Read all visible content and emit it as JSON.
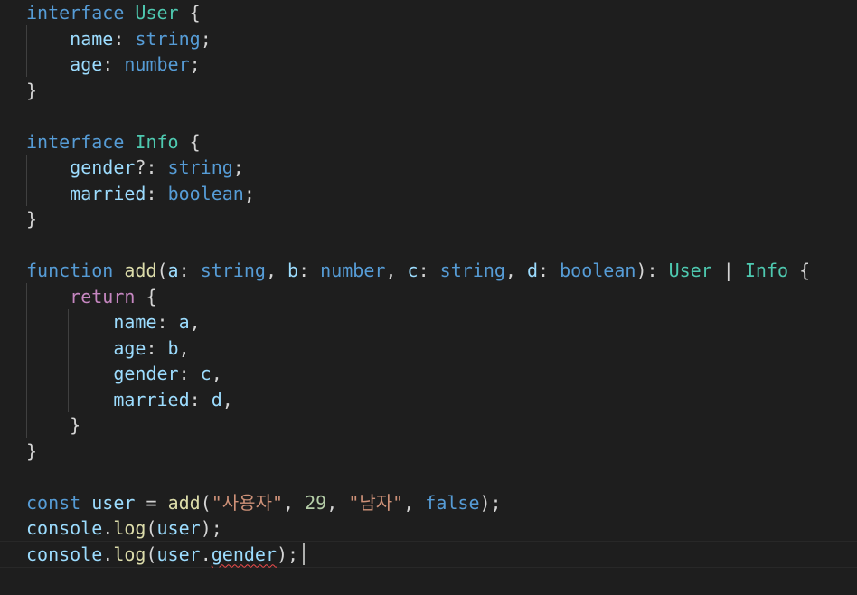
{
  "editor": {
    "language": "typescript",
    "lines": [
      {
        "tokens": [
          {
            "t": "interface",
            "c": "kw"
          },
          {
            "t": " ",
            "c": "plain"
          },
          {
            "t": "User",
            "c": "type"
          },
          {
            "t": " {",
            "c": "plain"
          }
        ]
      },
      {
        "tokens": [
          {
            "t": "    ",
            "c": "plain"
          },
          {
            "t": "name",
            "c": "var"
          },
          {
            "t": ": ",
            "c": "plain"
          },
          {
            "t": "string",
            "c": "kw"
          },
          {
            "t": ";",
            "c": "plain"
          }
        ]
      },
      {
        "tokens": [
          {
            "t": "    ",
            "c": "plain"
          },
          {
            "t": "age",
            "c": "var"
          },
          {
            "t": ": ",
            "c": "plain"
          },
          {
            "t": "number",
            "c": "kw"
          },
          {
            "t": ";",
            "c": "plain"
          }
        ]
      },
      {
        "tokens": [
          {
            "t": "}",
            "c": "plain"
          }
        ]
      },
      {
        "tokens": []
      },
      {
        "tokens": [
          {
            "t": "interface",
            "c": "kw"
          },
          {
            "t": " ",
            "c": "plain"
          },
          {
            "t": "Info",
            "c": "type"
          },
          {
            "t": " {",
            "c": "plain"
          }
        ]
      },
      {
        "tokens": [
          {
            "t": "    ",
            "c": "plain"
          },
          {
            "t": "gender",
            "c": "var"
          },
          {
            "t": "?: ",
            "c": "plain"
          },
          {
            "t": "string",
            "c": "kw"
          },
          {
            "t": ";",
            "c": "plain"
          }
        ]
      },
      {
        "tokens": [
          {
            "t": "    ",
            "c": "plain"
          },
          {
            "t": "married",
            "c": "var"
          },
          {
            "t": ": ",
            "c": "plain"
          },
          {
            "t": "boolean",
            "c": "kw"
          },
          {
            "t": ";",
            "c": "plain"
          }
        ]
      },
      {
        "tokens": [
          {
            "t": "}",
            "c": "plain"
          }
        ]
      },
      {
        "tokens": []
      },
      {
        "tokens": [
          {
            "t": "function",
            "c": "kw"
          },
          {
            "t": " ",
            "c": "plain"
          },
          {
            "t": "add",
            "c": "fn"
          },
          {
            "t": "(",
            "c": "plain"
          },
          {
            "t": "a",
            "c": "var"
          },
          {
            "t": ": ",
            "c": "plain"
          },
          {
            "t": "string",
            "c": "kw"
          },
          {
            "t": ", ",
            "c": "plain"
          },
          {
            "t": "b",
            "c": "var"
          },
          {
            "t": ": ",
            "c": "plain"
          },
          {
            "t": "number",
            "c": "kw"
          },
          {
            "t": ", ",
            "c": "plain"
          },
          {
            "t": "c",
            "c": "var"
          },
          {
            "t": ": ",
            "c": "plain"
          },
          {
            "t": "string",
            "c": "kw"
          },
          {
            "t": ", ",
            "c": "plain"
          },
          {
            "t": "d",
            "c": "var"
          },
          {
            "t": ": ",
            "c": "plain"
          },
          {
            "t": "boolean",
            "c": "kw"
          },
          {
            "t": "): ",
            "c": "plain"
          },
          {
            "t": "User",
            "c": "type"
          },
          {
            "t": " | ",
            "c": "plain"
          },
          {
            "t": "Info",
            "c": "type"
          },
          {
            "t": " {",
            "c": "plain"
          }
        ]
      },
      {
        "tokens": [
          {
            "t": "    ",
            "c": "plain"
          },
          {
            "t": "return",
            "c": "ctl"
          },
          {
            "t": " {",
            "c": "plain"
          }
        ]
      },
      {
        "tokens": [
          {
            "t": "        ",
            "c": "plain"
          },
          {
            "t": "name",
            "c": "var"
          },
          {
            "t": ": ",
            "c": "plain"
          },
          {
            "t": "a",
            "c": "var"
          },
          {
            "t": ",",
            "c": "plain"
          }
        ]
      },
      {
        "tokens": [
          {
            "t": "        ",
            "c": "plain"
          },
          {
            "t": "age",
            "c": "var"
          },
          {
            "t": ": ",
            "c": "plain"
          },
          {
            "t": "b",
            "c": "var"
          },
          {
            "t": ",",
            "c": "plain"
          }
        ]
      },
      {
        "tokens": [
          {
            "t": "        ",
            "c": "plain"
          },
          {
            "t": "gender",
            "c": "var"
          },
          {
            "t": ": ",
            "c": "plain"
          },
          {
            "t": "c",
            "c": "var"
          },
          {
            "t": ",",
            "c": "plain"
          }
        ]
      },
      {
        "tokens": [
          {
            "t": "        ",
            "c": "plain"
          },
          {
            "t": "married",
            "c": "var"
          },
          {
            "t": ": ",
            "c": "plain"
          },
          {
            "t": "d",
            "c": "var"
          },
          {
            "t": ",",
            "c": "plain"
          }
        ]
      },
      {
        "tokens": [
          {
            "t": "    ",
            "c": "plain"
          },
          {
            "t": "}",
            "c": "plain"
          }
        ]
      },
      {
        "tokens": [
          {
            "t": "}",
            "c": "plain"
          }
        ]
      },
      {
        "tokens": []
      },
      {
        "tokens": [
          {
            "t": "const",
            "c": "kw"
          },
          {
            "t": " ",
            "c": "plain"
          },
          {
            "t": "user",
            "c": "var"
          },
          {
            "t": " = ",
            "c": "plain"
          },
          {
            "t": "add",
            "c": "fn"
          },
          {
            "t": "(",
            "c": "plain"
          },
          {
            "t": "\"사용자\"",
            "c": "str"
          },
          {
            "t": ", ",
            "c": "plain"
          },
          {
            "t": "29",
            "c": "num"
          },
          {
            "t": ", ",
            "c": "plain"
          },
          {
            "t": "\"남자\"",
            "c": "str"
          },
          {
            "t": ", ",
            "c": "plain"
          },
          {
            "t": "false",
            "c": "kw"
          },
          {
            "t": ");",
            "c": "plain"
          }
        ]
      },
      {
        "tokens": [
          {
            "t": "console",
            "c": "var"
          },
          {
            "t": ".",
            "c": "plain"
          },
          {
            "t": "log",
            "c": "fn"
          },
          {
            "t": "(",
            "c": "plain"
          },
          {
            "t": "user",
            "c": "var"
          },
          {
            "t": ");",
            "c": "plain"
          }
        ]
      },
      {
        "tokens": [
          {
            "t": "console",
            "c": "var"
          },
          {
            "t": ".",
            "c": "plain"
          },
          {
            "t": "log",
            "c": "fn"
          },
          {
            "t": "(",
            "c": "plain"
          },
          {
            "t": "user",
            "c": "var"
          },
          {
            "t": ".",
            "c": "plain"
          },
          {
            "t": "gender",
            "c": "var",
            "err": true
          },
          {
            "t": ");",
            "c": "plain"
          }
        ]
      }
    ]
  },
  "colors": {
    "background": "#1e1e1e",
    "keyword": "#569cd6",
    "type": "#4ec9b0",
    "function": "#dcdcaa",
    "variable": "#9cdcfe",
    "string": "#ce9178",
    "number": "#b5cea8",
    "control": "#c586c0",
    "error_squiggle": "#f14c4c"
  }
}
